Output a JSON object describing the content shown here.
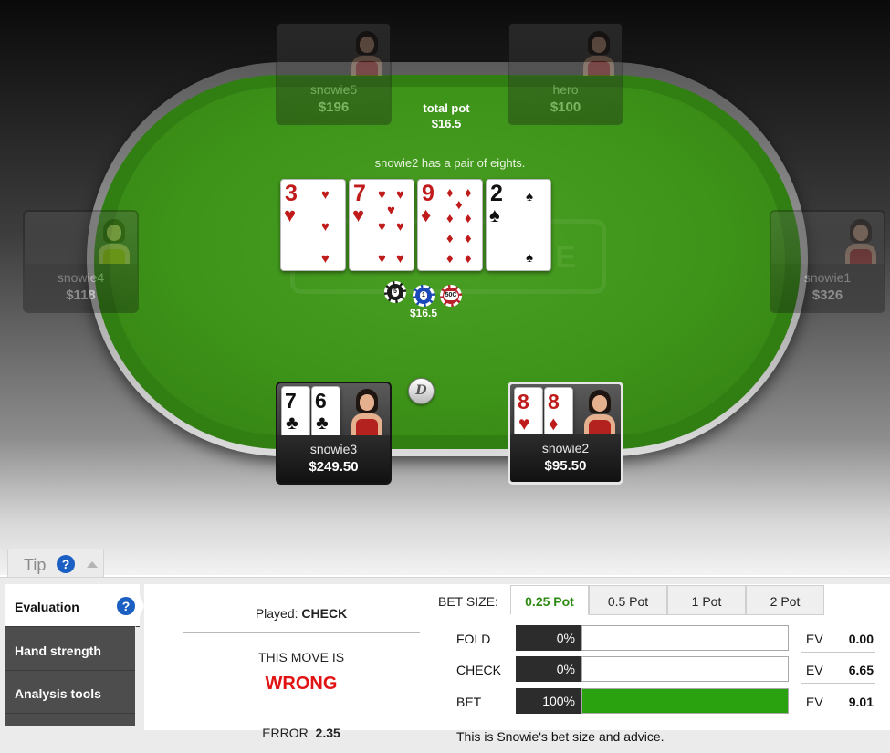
{
  "colors": {
    "felt": "#3e9419",
    "bet_fill": "#2aa20f",
    "verdict": "#e11313",
    "selected_size": "#2d8a12"
  },
  "table": {
    "pot_label": "total pot",
    "pot_amount": "$16.5",
    "message": "snowie2 has a pair of eights.",
    "bet_amount": "$16.5",
    "chips": [
      "5",
      "1",
      "50C"
    ],
    "dealer": "D",
    "logo_text": "E",
    "board": [
      {
        "rank": "3",
        "suit": "♥",
        "color": "red"
      },
      {
        "rank": "7",
        "suit": "♥",
        "color": "red"
      },
      {
        "rank": "9",
        "suit": "♦",
        "color": "red"
      },
      {
        "rank": "2",
        "suit": "♠",
        "color": "black"
      }
    ],
    "seats": {
      "snowie5": {
        "name": "snowie5",
        "stack": "$196"
      },
      "hero": {
        "name": "hero",
        "stack": "$100"
      },
      "snowie4": {
        "name": "snowie4",
        "stack": "$118"
      },
      "snowie1": {
        "name": "snowie1",
        "stack": "$326"
      },
      "snowie3": {
        "name": "snowie3",
        "stack": "$249.50",
        "cards": [
          {
            "rank": "7",
            "suit": "♣"
          },
          {
            "rank": "6",
            "suit": "♣"
          }
        ]
      },
      "snowie2": {
        "name": "snowie2",
        "stack": "$95.50",
        "cards": [
          {
            "rank": "8",
            "suit": "♥"
          },
          {
            "rank": "8",
            "suit": "♦"
          }
        ]
      }
    }
  },
  "tip": {
    "label": "Tip",
    "help": "?",
    "nav": [
      "Evaluation",
      "Hand strength",
      "Analysis tools"
    ],
    "played_label": "Played:",
    "played_value": "CHECK",
    "move_is": "THIS MOVE IS",
    "verdict": "WRONG",
    "error_label": "ERROR",
    "error_value": "2.35",
    "bet_size_label": "BET SIZE:",
    "bet_sizes": [
      "0.25 Pot",
      "0.5 Pot",
      "1 Pot",
      "2 Pot"
    ],
    "ev_label": "EV",
    "actions": [
      {
        "label": "FOLD",
        "pct": "0%",
        "fraction": 0,
        "ev": "0.00"
      },
      {
        "label": "CHECK",
        "pct": "0%",
        "fraction": 0,
        "ev": "6.65"
      },
      {
        "label": "BET",
        "pct": "100%",
        "fraction": 1,
        "ev": "9.01"
      }
    ],
    "advice": "This is Snowie's bet size and advice."
  }
}
